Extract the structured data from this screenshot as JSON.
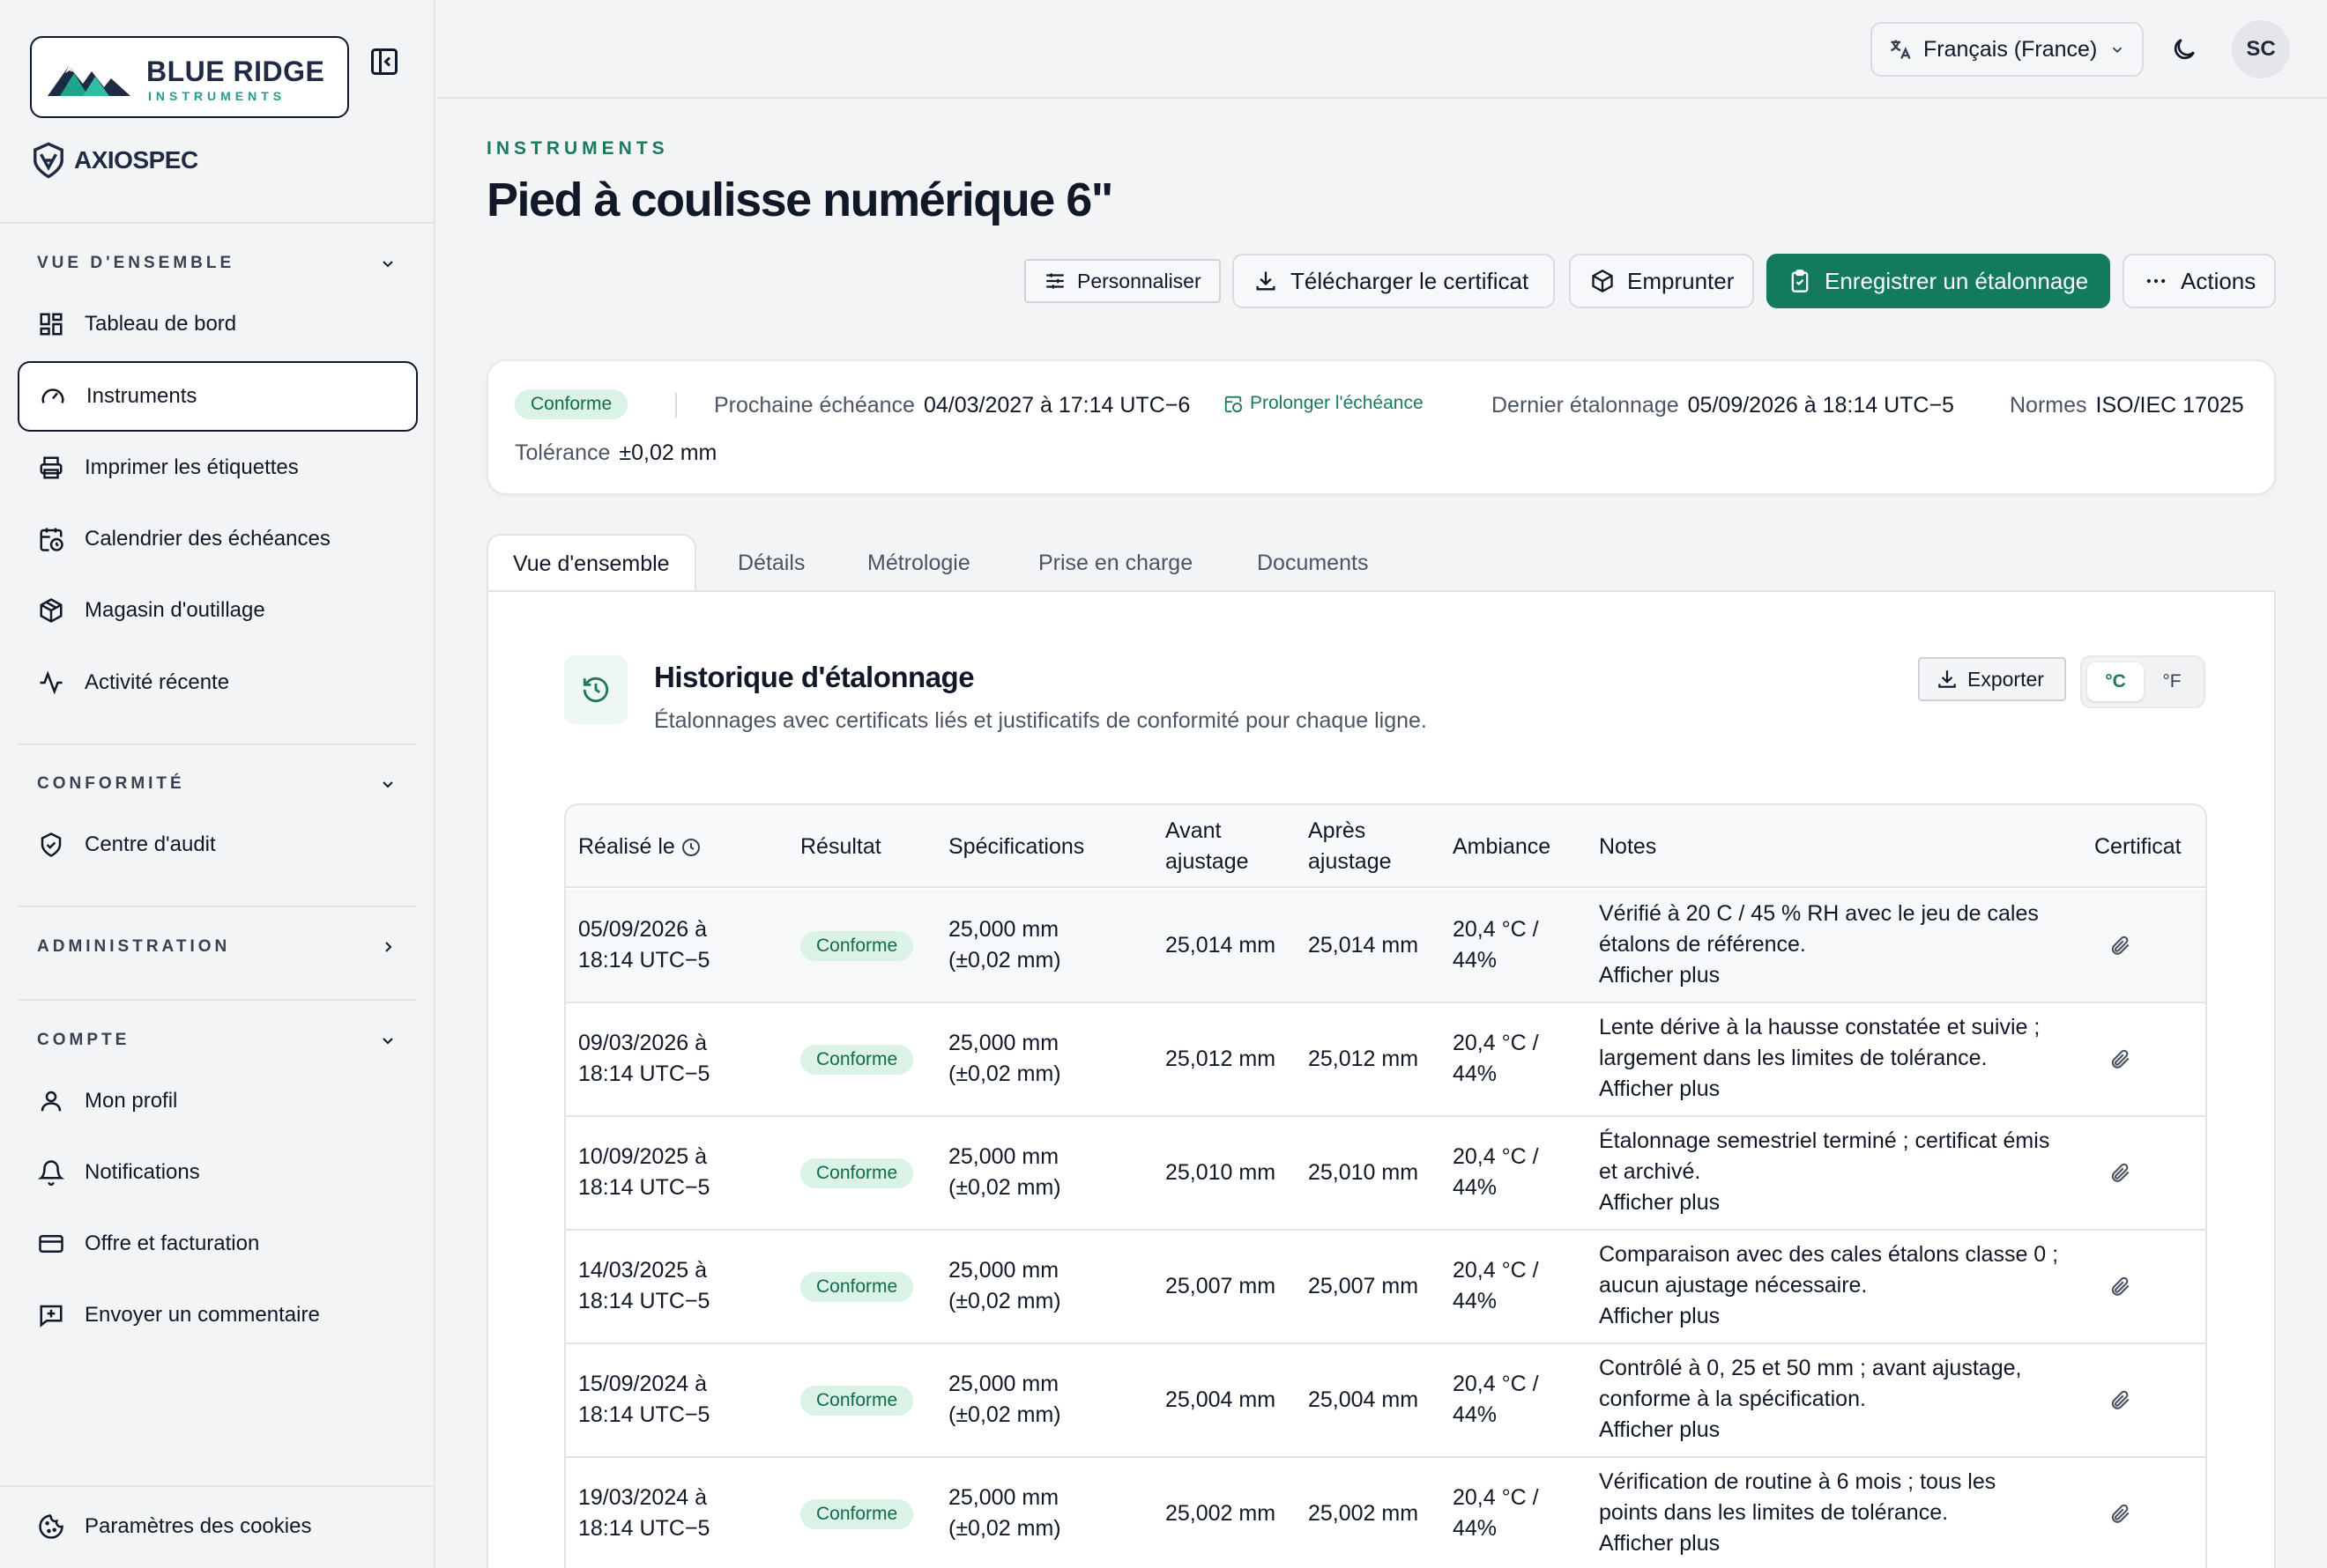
{
  "brand": {
    "name": "BLUE RIDGE",
    "sub": "INSTRUMENTS",
    "product": "AXIOSPEC"
  },
  "sidebar": {
    "sections": [
      {
        "title": "VUE D'ENSEMBLE",
        "items": [
          {
            "label": "Tableau de bord",
            "icon": "dashboard-icon"
          },
          {
            "label": "Instruments",
            "icon": "gauge-icon",
            "active": true
          },
          {
            "label": "Imprimer les étiquettes",
            "icon": "printer-icon"
          },
          {
            "label": "Calendrier des échéances",
            "icon": "calendar-clock-icon"
          },
          {
            "label": "Magasin d'outillage",
            "icon": "package-icon"
          },
          {
            "label": "Activité récente",
            "icon": "activity-icon"
          }
        ]
      },
      {
        "title": "CONFORMITÉ",
        "items": [
          {
            "label": "Centre d'audit",
            "icon": "shield-check-icon"
          }
        ]
      },
      {
        "title": "ADMINISTRATION",
        "items": []
      },
      {
        "title": "COMPTE",
        "items": [
          {
            "label": "Mon profil",
            "icon": "user-icon"
          },
          {
            "label": "Notifications",
            "icon": "bell-icon"
          },
          {
            "label": "Offre et facturation",
            "icon": "credit-card-icon"
          },
          {
            "label": "Envoyer un commentaire",
            "icon": "message-plus-icon"
          }
        ]
      }
    ],
    "footer": {
      "label": "Paramètres des cookies",
      "icon": "cookie-icon"
    }
  },
  "topbar": {
    "language": "Français (France)",
    "avatar_initials": "SC"
  },
  "page": {
    "eyebrow": "INSTRUMENTS",
    "title": "Pied à coulisse numérique 6\"",
    "buttons": {
      "customize": "Personnaliser",
      "download": "Télécharger le certificat",
      "borrow": "Emprunter",
      "record": "Enregistrer un étalonnage",
      "actions": "Actions"
    }
  },
  "summary": {
    "status": "Conforme",
    "next_due_label": "Prochaine échéance",
    "next_due_value": "04/03/2027 à 17:14 UTC−6",
    "extend_label": "Prolonger l'échéance",
    "last_cal_label": "Dernier étalonnage",
    "last_cal_value": "05/09/2026 à 18:14 UTC−5",
    "standards_label": "Normes",
    "standards_value": "ISO/IEC 17025",
    "tolerance_label": "Tolérance",
    "tolerance_value": "±0,02 mm"
  },
  "tabs": [
    "Vue d'ensemble",
    "Détails",
    "Métrologie",
    "Prise en charge",
    "Documents"
  ],
  "history": {
    "title": "Historique d'étalonnage",
    "subtitle": "Étalonnages avec certificats liés et justificatifs de conformité pour chaque ligne.",
    "export_label": "Exporter",
    "unit_c": "°C",
    "unit_f": "°F",
    "columns": {
      "date": "Réalisé le",
      "result": "Résultat",
      "spec": "Spécifications",
      "before_1": "Avant",
      "before_2": "ajustage",
      "after_1": "Après",
      "after_2": "ajustage",
      "ambient": "Ambiance",
      "notes": "Notes",
      "cert": "Certificat"
    },
    "rows": [
      {
        "date_1": "05/09/2026 à",
        "date_2": "18:14 UTC−5",
        "result": "Conforme",
        "spec_1": "25,000 mm",
        "spec_2": "(±0,02 mm)",
        "before": "25,014 mm",
        "after": "25,014 mm",
        "amb_1": "20,4 °C /",
        "amb_2": "44%",
        "note_1": "Vérifié à 20 C / 45 % RH avec le jeu de cales",
        "note_2": "étalons de référence.",
        "more": "Afficher plus"
      },
      {
        "date_1": "09/03/2026 à",
        "date_2": "18:14 UTC−5",
        "result": "Conforme",
        "spec_1": "25,000 mm",
        "spec_2": "(±0,02 mm)",
        "before": "25,012 mm",
        "after": "25,012 mm",
        "amb_1": "20,4 °C /",
        "amb_2": "44%",
        "note_1": "Lente dérive à la hausse constatée et suivie ;",
        "note_2": "largement dans les limites de tolérance.",
        "more": "Afficher plus"
      },
      {
        "date_1": "10/09/2025 à",
        "date_2": "18:14 UTC−5",
        "result": "Conforme",
        "spec_1": "25,000 mm",
        "spec_2": "(±0,02 mm)",
        "before": "25,010 mm",
        "after": "25,010 mm",
        "amb_1": "20,4 °C /",
        "amb_2": "44%",
        "note_1": "Étalonnage semestriel terminé ; certificat émis",
        "note_2": "et archivé.",
        "more": "Afficher plus"
      },
      {
        "date_1": "14/03/2025 à",
        "date_2": "18:14 UTC−5",
        "result": "Conforme",
        "spec_1": "25,000 mm",
        "spec_2": "(±0,02 mm)",
        "before": "25,007 mm",
        "after": "25,007 mm",
        "amb_1": "20,4 °C /",
        "amb_2": "44%",
        "note_1": "Comparaison avec des cales étalons classe 0 ;",
        "note_2": "aucun ajustage nécessaire.",
        "more": "Afficher plus"
      },
      {
        "date_1": "15/09/2024 à",
        "date_2": "18:14 UTC−5",
        "result": "Conforme",
        "spec_1": "25,000 mm",
        "spec_2": "(±0,02 mm)",
        "before": "25,004 mm",
        "after": "25,004 mm",
        "amb_1": "20,4 °C /",
        "amb_2": "44%",
        "note_1": "Contrôlé à 0, 25 et 50 mm ; avant ajustage,",
        "note_2": "conforme à la spécification.",
        "more": "Afficher plus"
      },
      {
        "date_1": "19/03/2024 à",
        "date_2": "18:14 UTC−5",
        "result": "Conforme",
        "spec_1": "25,000 mm",
        "spec_2": "(±0,02 mm)",
        "before": "25,002 mm",
        "after": "25,002 mm",
        "amb_1": "20,4 °C /",
        "amb_2": "44%",
        "note_1": "Vérification de routine à 6 mois ; tous les",
        "note_2": "points dans les limites de tolérance.",
        "more": "Afficher plus"
      }
    ]
  },
  "colors": {
    "accent": "#137a5e",
    "badge_bg": "#daf3e6",
    "badge_text": "#136b4f"
  }
}
